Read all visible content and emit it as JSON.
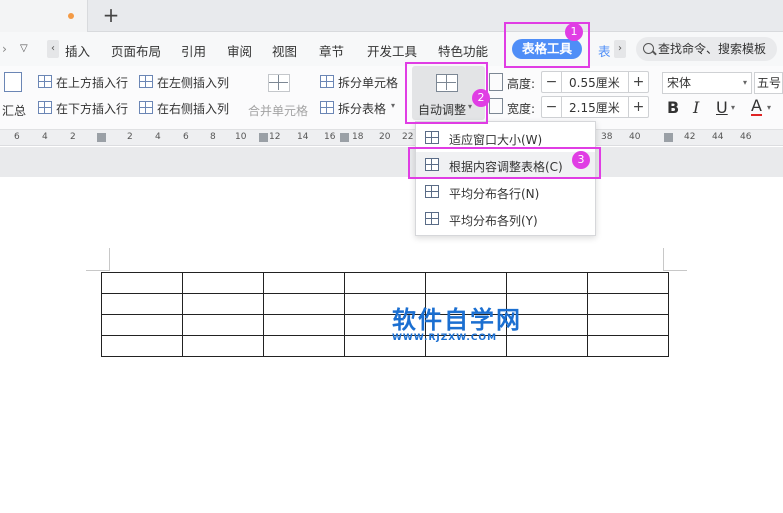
{
  "tabbar": {
    "new_tab_symbol": "+"
  },
  "menu": {
    "items": [
      "插入",
      "页面布局",
      "引用",
      "审阅",
      "视图",
      "章节",
      "开发工具",
      "特色功能"
    ],
    "active_tab": "表格工具",
    "next_tab_partial": "表",
    "search_placeholder": "查找命令、搜索模板",
    "accent_color": "#4f8ef7"
  },
  "ribbon": {
    "summary": "汇总",
    "insert_above": "在上方插入行",
    "insert_below": "在下方插入行",
    "insert_left": "在左侧插入列",
    "insert_right": "在右侧插入列",
    "merge_cells": "合并单元格",
    "split_cells": "拆分单元格",
    "split_table": "拆分表格",
    "auto_fit": "自动调整",
    "height_label": "高度:",
    "height_value": "0.55厘米",
    "width_label": "宽度:",
    "width_value": "2.15厘米",
    "font_name": "宋体",
    "font_size": "五号",
    "bold": "B",
    "italic": "I",
    "underline": "U",
    "font_color": "A"
  },
  "ruler": {
    "ticks": [
      "6",
      "4",
      "2",
      "2",
      "4",
      "6",
      "8",
      "10",
      "12",
      "14",
      "16",
      "18",
      "20",
      "22",
      "38",
      "40",
      "42",
      "44",
      "46"
    ]
  },
  "dropdown": {
    "items": [
      "适应窗口大小(W)",
      "根据内容调整表格(C)",
      "平均分布各行(N)",
      "平均分布各列(Y)"
    ]
  },
  "watermark": {
    "main": "软件自学网",
    "sub": "WWW.RJZXW.COM"
  },
  "annotations": {
    "badges": [
      "1",
      "2",
      "3"
    ],
    "color": "#e03de4"
  },
  "table": {
    "rows": 4,
    "cols": 7
  }
}
